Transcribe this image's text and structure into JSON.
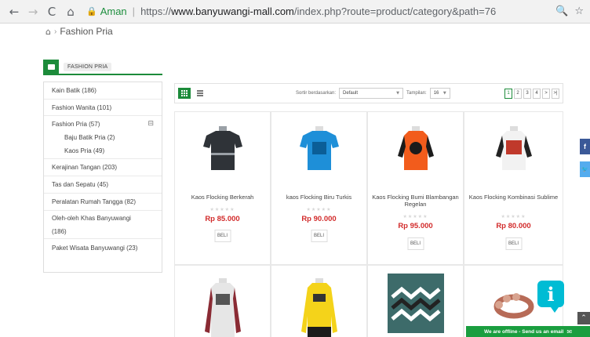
{
  "browser": {
    "url_secure_label": "Aman",
    "url_scheme": "https://",
    "url_host": "www.banyuwangi-mall.com",
    "url_path": "/index.php?route=product/category&path=76"
  },
  "breadcrumb": {
    "current": "Fashion Pria"
  },
  "category_box": {
    "title": "FASHION PRIA"
  },
  "sidebar": {
    "items": [
      {
        "label": "Kain Batik (186)"
      },
      {
        "label": "Fashion Wanita (101)"
      },
      {
        "label": "Fashion Pria (57)"
      },
      {
        "label": "Kerajinan Tangan (203)"
      },
      {
        "label": "Tas dan Sepatu (45)"
      },
      {
        "label": "Peralatan Rumah Tangga (82)"
      },
      {
        "label": "Oleh-oleh Khas Banyuwangi (186)"
      },
      {
        "label": "Paket Wisata Banyuwangi (23)"
      }
    ],
    "subitems": [
      {
        "label": "Baju Batik Pria (2)"
      },
      {
        "label": "Kaos Pria (49)"
      }
    ]
  },
  "toolbar": {
    "sort_label": "Sortir berdasarkan:",
    "sort_value": "Default",
    "limit_label": "Tampilan:",
    "limit_value": "16",
    "pages": [
      "1",
      "2",
      "3",
      "4",
      ">",
      ">|"
    ]
  },
  "products": [
    {
      "name": "Kaos Flocking Berkerah",
      "price": "Rp 85.000",
      "buy": "BELI",
      "stars": "★★★★★",
      "colors": {
        "body": "#2f3338",
        "accent": "#9aa0a6"
      }
    },
    {
      "name": "kaos Flocking Biru Turkis",
      "price": "Rp 90.000",
      "buy": "BELI",
      "stars": "★★★★★",
      "colors": {
        "body": "#1e8fd8",
        "accent": "#0b5e97"
      }
    },
    {
      "name": "Kaos Flocking Bumi Blambangan Regelan",
      "price": "Rp 95.000",
      "buy": "BELI",
      "stars": "★★★★★",
      "colors": {
        "body": "#f25c1c",
        "accent": "#1b1b1b"
      }
    },
    {
      "name": "Kaos Flocking Kombinasi Sublime",
      "price": "Rp 80.000",
      "buy": "BELI",
      "stars": "★★★★★",
      "colors": {
        "body": "#f2f2f2",
        "accent": "#222222"
      }
    },
    {
      "colors": {
        "body": "#e6e6e6",
        "accent": "#8a2b34"
      }
    },
    {
      "colors": {
        "body": "#f4d31a",
        "accent": "#1b1b1b"
      }
    },
    {
      "colors": {
        "body": "#3d6b6a",
        "accent": "#ffffff"
      }
    },
    {
      "colors": {
        "body": "#d8a38f",
        "accent": "#b76b57"
      }
    }
  ],
  "chat": {
    "label": "We are offline - Send us an email"
  }
}
